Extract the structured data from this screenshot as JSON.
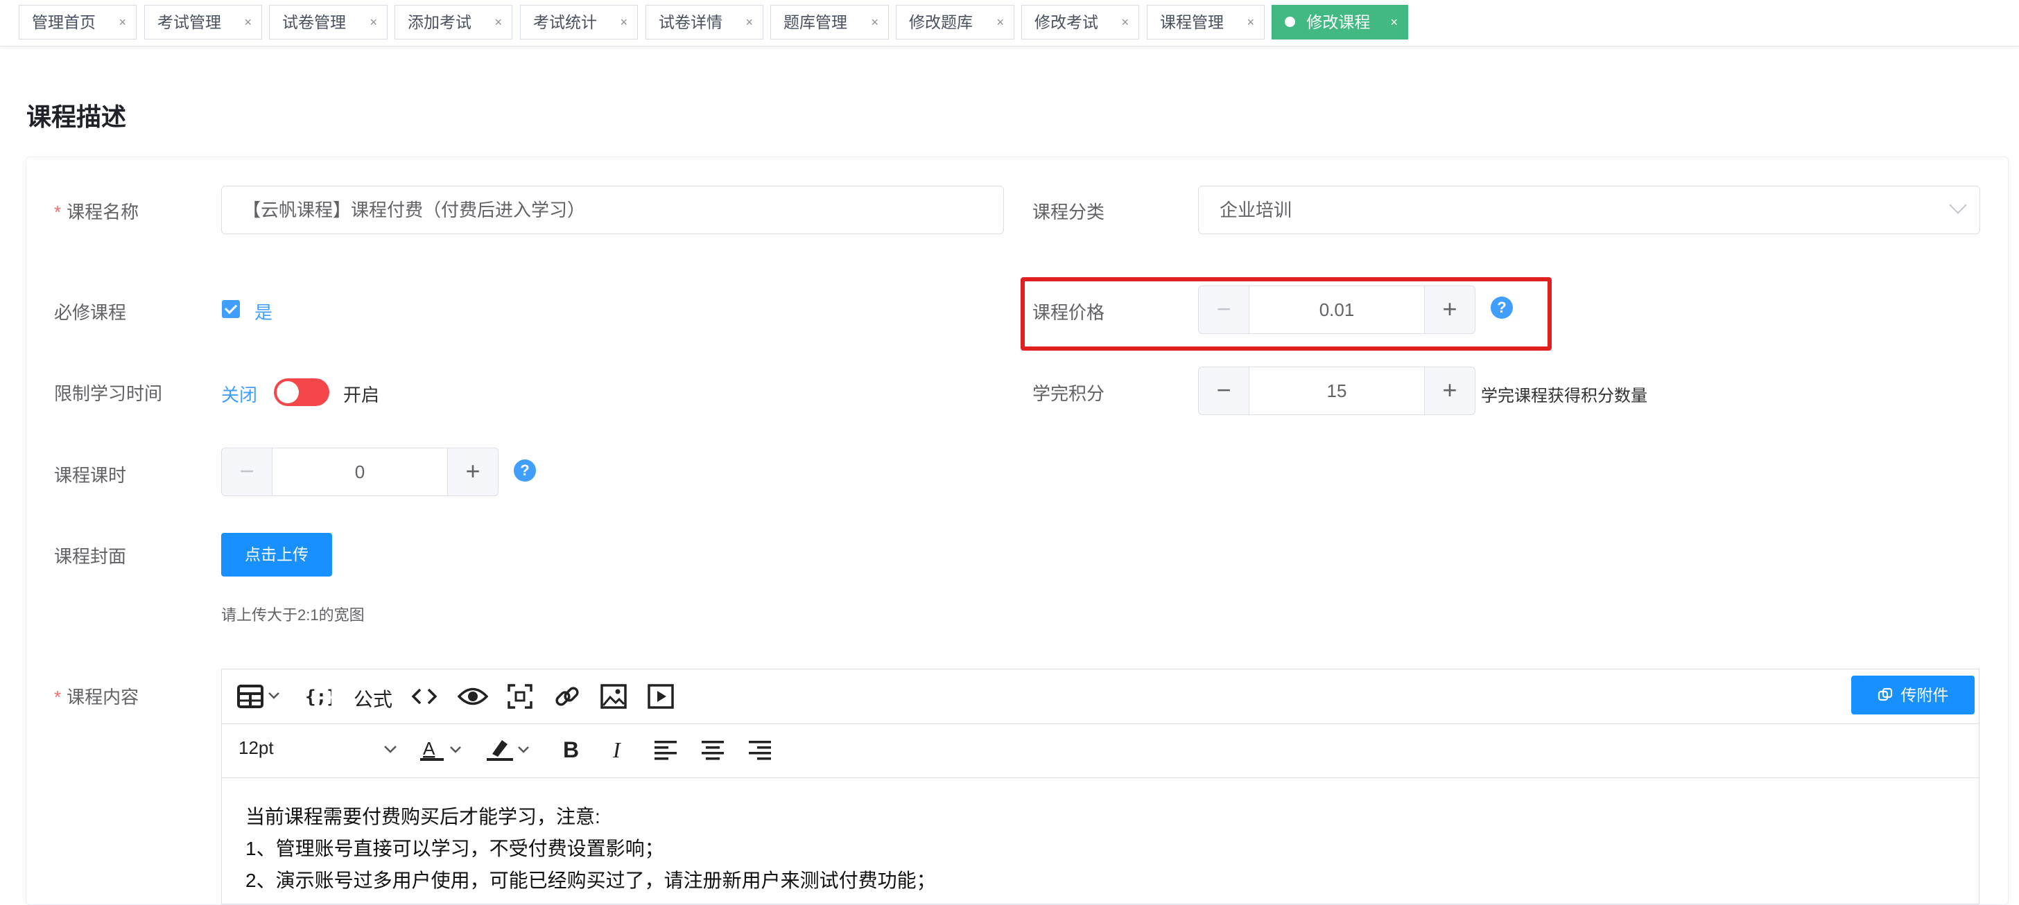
{
  "tabs": [
    {
      "label": "管理首页",
      "active": false
    },
    {
      "label": "考试管理",
      "active": false
    },
    {
      "label": "试卷管理",
      "active": false
    },
    {
      "label": "添加考试",
      "active": false
    },
    {
      "label": "考试统计",
      "active": false
    },
    {
      "label": "试卷详情",
      "active": false
    },
    {
      "label": "题库管理",
      "active": false
    },
    {
      "label": "修改题库",
      "active": false
    },
    {
      "label": "修改考试",
      "active": false
    },
    {
      "label": "课程管理",
      "active": false
    },
    {
      "label": "修改课程",
      "active": true
    }
  ],
  "tab_close_glyph": "×",
  "section_title": "课程描述",
  "form": {
    "required_mark": "*",
    "course_name": {
      "label": "课程名称",
      "value": "【云帆课程】课程付费（付费后进入学习）"
    },
    "course_category": {
      "label": "课程分类",
      "value": "企业培训"
    },
    "required_course": {
      "label": "必修课程",
      "checkbox_label": "是",
      "checked": true
    },
    "course_price": {
      "label": "课程价格",
      "value": "0.01"
    },
    "limit_time": {
      "label": "限制学习时间",
      "off_label": "关闭",
      "on_label": "开启"
    },
    "completion_points": {
      "label": "学完积分",
      "value": "15",
      "hint": "学完课程获得积分数量"
    },
    "course_hours": {
      "label": "课程课时",
      "value": "0"
    },
    "course_cover": {
      "label": "课程封面",
      "button": "点击上传",
      "hint": "请上传大于2:1的宽图"
    },
    "course_content": {
      "label": "课程内容"
    }
  },
  "stepper": {
    "minus": "−",
    "plus": "+"
  },
  "help_glyph": "?",
  "editor": {
    "formula_label": "公式",
    "font_size": "12pt",
    "attach_button": "传附件",
    "content_lines": [
      "当前课程需要付费购买后才能学习，注意:",
      "1、管理账号直接可以学习，不受付费设置影响；",
      "2、演示账号过多用户使用，可能已经购买过了，请注册新用户来测试付费功能；"
    ]
  },
  "colors": {
    "active_tab": "#42b983",
    "primary": "#1890ff",
    "highlight": "#e02020",
    "switch_off": "#f5474a"
  }
}
